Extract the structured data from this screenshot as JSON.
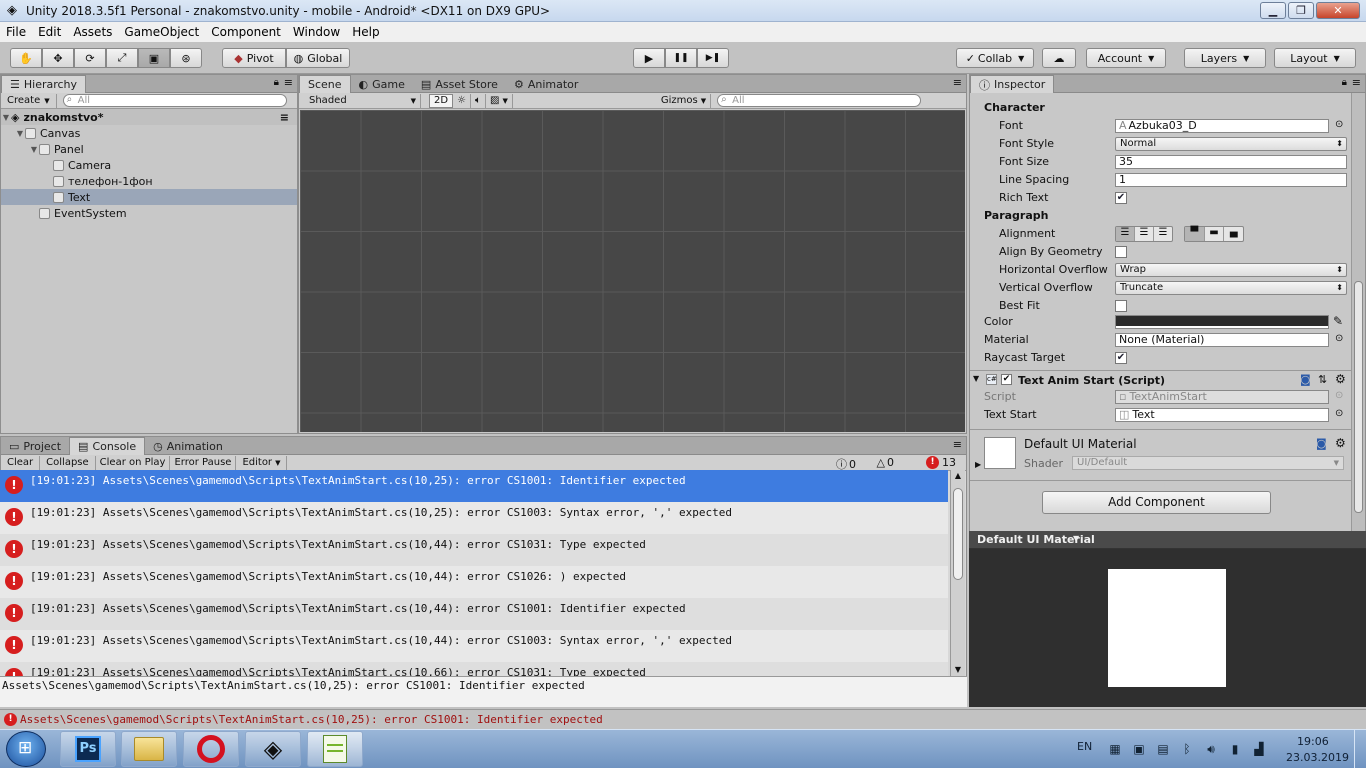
{
  "window": {
    "title": "Unity 2018.3.5f1 Personal - znakomstvo.unity - mobile - Android* <DX11 on DX9 GPU>",
    "minimize": "▁",
    "restore": "❐",
    "close": "✕"
  },
  "menu": [
    "File",
    "Edit",
    "Assets",
    "GameObject",
    "Component",
    "Window",
    "Help"
  ],
  "toolbar": {
    "pivot": "Pivot",
    "global": "Global",
    "collab": "Collab",
    "account": "Account",
    "layers": "Layers",
    "layout": "Layout",
    "play": "▶",
    "pause": "❚❚",
    "step": "▶❚"
  },
  "hierarchy": {
    "tab": "Hierarchy",
    "create": "Create",
    "search_placeholder": "All",
    "scene_name": "znakomstvo*",
    "items": [
      {
        "label": "Canvas"
      },
      {
        "label": "Panel"
      },
      {
        "label": "Camera"
      },
      {
        "label": "телефон-1фон"
      },
      {
        "label": "Text"
      },
      {
        "label": "EventSystem"
      }
    ]
  },
  "scene": {
    "tabs": [
      "Scene",
      "Game",
      "Asset Store",
      "Animator"
    ],
    "shaded": "Shaded",
    "mode_2d": "2D",
    "gizmos": "Gizmos",
    "search_placeholder": "All"
  },
  "inspector": {
    "tab": "Inspector",
    "character_header": "Character",
    "font_label": "Font",
    "font_value": "Azbuka03_D",
    "font_style_label": "Font Style",
    "font_style_value": "Normal",
    "font_size_label": "Font Size",
    "font_size_value": "35",
    "line_spacing_label": "Line Spacing",
    "line_spacing_value": "1",
    "rich_text_label": "Rich Text",
    "paragraph_header": "Paragraph",
    "alignment_label": "Alignment",
    "align_geometry_label": "Align By Geometry",
    "h_overflow_label": "Horizontal Overflow",
    "h_overflow_value": "Wrap",
    "v_overflow_label": "Vertical Overflow",
    "v_overflow_value": "Truncate",
    "best_fit_label": "Best Fit",
    "color_label": "Color",
    "color_value": "#2b2b2b",
    "material_label": "Material",
    "material_value": "None (Material)",
    "raycast_label": "Raycast Target",
    "component_title": "Text Anim Start (Script)",
    "script_label": "Script",
    "script_value": "TextAnimStart",
    "text_start_label": "Text Start",
    "text_start_value": "Text",
    "material_title": "Default UI Material",
    "shader_label": "Shader",
    "shader_value": "UI/Default",
    "add_component": "Add Component",
    "preview_title": "Default UI Material"
  },
  "bottom_tabs": [
    "Project",
    "Console",
    "Animation"
  ],
  "console": {
    "buttons": [
      "Clear",
      "Collapse",
      "Clear on Play",
      "Error Pause",
      "Editor"
    ],
    "info_count": "0",
    "warning_count": "0",
    "error_count": "13",
    "messages": [
      "[19:01:23] Assets\\Scenes\\gamemod\\Scripts\\TextAnimStart.cs(10,25): error CS1001: Identifier expected",
      "[19:01:23] Assets\\Scenes\\gamemod\\Scripts\\TextAnimStart.cs(10,25): error CS1003: Syntax error, ',' expected",
      "[19:01:23] Assets\\Scenes\\gamemod\\Scripts\\TextAnimStart.cs(10,44): error CS1031: Type expected",
      "[19:01:23] Assets\\Scenes\\gamemod\\Scripts\\TextAnimStart.cs(10,44): error CS1026: ) expected",
      "[19:01:23] Assets\\Scenes\\gamemod\\Scripts\\TextAnimStart.cs(10,44): error CS1001: Identifier expected",
      "[19:01:23] Assets\\Scenes\\gamemod\\Scripts\\TextAnimStart.cs(10,44): error CS1003: Syntax error, ',' expected",
      "[19:01:23] Assets\\Scenes\\gamemod\\Scripts\\TextAnimStart.cs(10,66): error CS1031: Type expected"
    ],
    "detail": "Assets\\Scenes\\gamemod\\Scripts\\TextAnimStart.cs(10,25): error CS1001: Identifier expected",
    "status": "Assets\\Scenes\\gamemod\\Scripts\\TextAnimStart.cs(10,25): error CS1001: Identifier expected"
  },
  "taskbar": {
    "apps": [
      "Ps",
      "Files",
      "O",
      "Unity",
      "Notepad++"
    ],
    "lang": "EN",
    "time": "19:06",
    "date": "23.03.2019"
  }
}
